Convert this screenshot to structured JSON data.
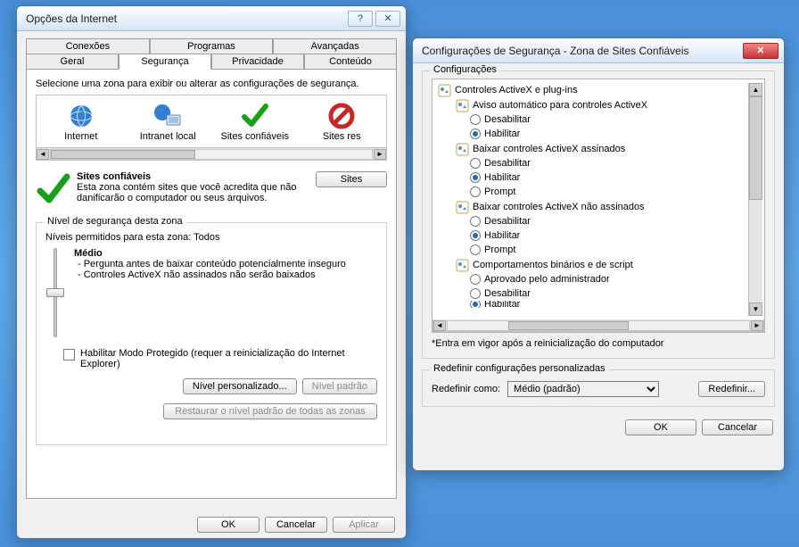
{
  "dialog_options": {
    "title": "Opções da Internet",
    "tabs_row1": [
      "Conexões",
      "Programas",
      "Avançadas"
    ],
    "tabs_row2": [
      "Geral",
      "Segurança",
      "Privacidade",
      "Conteúdo"
    ],
    "active_tab": "Segurança",
    "hint": "Selecione uma zona para exibir ou alterar as configurações de segurança.",
    "zones": [
      {
        "label": "Internet"
      },
      {
        "label": "Intranet local"
      },
      {
        "label": "Sites confiáveis"
      },
      {
        "label": "Sites res"
      }
    ],
    "selected_zone": {
      "title": "Sites confiáveis",
      "desc": "Esta zona contém sites que você acredita que não danificarão o computador ou seus arquivos.",
      "sites_btn": "Sites"
    },
    "level_group": {
      "legend": "Nível de segurança desta zona",
      "allowed": "Níveis permitidos para esta zona: Todos",
      "level_name": "Médio",
      "bullet1": "- Pergunta antes de baixar conteúdo potencialmente inseguro",
      "bullet2": "- Controles ActiveX não assinados não serão baixados",
      "protected_label": "Habilitar Modo Protegido (requer a reinicialização do Internet Explorer)",
      "custom_btn": "Nível personalizado...",
      "default_btn": "Nível padrão",
      "reset_all_btn": "Restaurar o nível padrão de todas as zonas"
    },
    "footer": {
      "ok": "OK",
      "cancel": "Cancelar",
      "apply": "Aplicar"
    }
  },
  "dialog_security": {
    "title": "Configurações de Segurança - Zona de Sites Confiáveis",
    "group_legend": "Configurações",
    "tree": [
      {
        "type": "cat",
        "label": "Controles ActiveX e plug-ins"
      },
      {
        "type": "subcat",
        "label": "Aviso automático para controles ActiveX"
      },
      {
        "type": "opt",
        "label": "Desabilitar",
        "selected": false
      },
      {
        "type": "opt",
        "label": "Habilitar",
        "selected": true
      },
      {
        "type": "subcat",
        "label": "Baixar controles ActiveX assinados"
      },
      {
        "type": "opt",
        "label": "Desabilitar",
        "selected": false
      },
      {
        "type": "opt",
        "label": "Habilitar",
        "selected": true
      },
      {
        "type": "opt",
        "label": "Prompt",
        "selected": false
      },
      {
        "type": "subcat",
        "label": "Baixar controles ActiveX não assinados"
      },
      {
        "type": "opt",
        "label": "Desabilitar",
        "selected": false
      },
      {
        "type": "opt",
        "label": "Habilitar",
        "selected": true
      },
      {
        "type": "opt",
        "label": "Prompt",
        "selected": false
      },
      {
        "type": "subcat",
        "label": "Comportamentos binários e de script"
      },
      {
        "type": "opt",
        "label": "Aprovado pelo administrador",
        "selected": false
      },
      {
        "type": "opt",
        "label": "Desabilitar",
        "selected": false
      },
      {
        "type": "opt",
        "label": "Habilitar",
        "selected": true,
        "cut": true
      }
    ],
    "footnote": "*Entra em vigor após a reinicialização do computador",
    "reset": {
      "legend": "Redefinir configurações personalizadas",
      "label": "Redefinir como:",
      "select": "Médio (padrão)",
      "button": "Redefinir..."
    },
    "footer": {
      "ok": "OK",
      "cancel": "Cancelar"
    }
  }
}
